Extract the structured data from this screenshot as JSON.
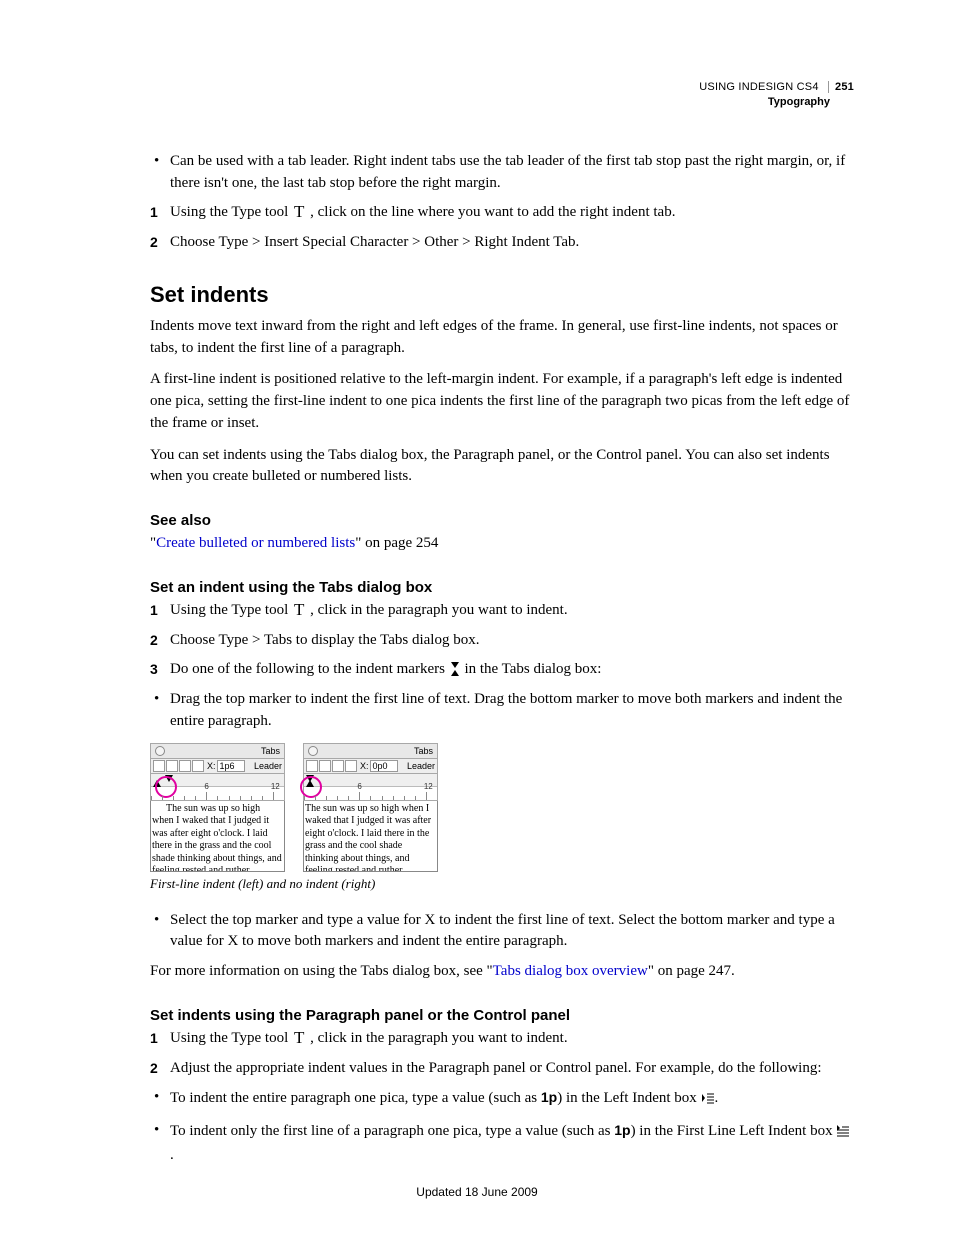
{
  "header": {
    "doc_title": "USING INDESIGN CS4",
    "page_number": "251",
    "section": "Typography"
  },
  "intro": {
    "bullet1": "Can be used with a tab leader. Right indent tabs use the tab leader of the first tab stop past the right margin, or, if there isn't one, the last tab stop before the right margin.",
    "step1a": "Using the Type tool ",
    "step1b": " , click on the line where you want to add the right indent tab.",
    "step2": "Choose Type > Insert Special Character > Other > Right Indent Tab."
  },
  "h_set_indents": "Set indents",
  "p1": "Indents move text inward from the right and left edges of the frame. In general, use first-line indents, not spaces or tabs, to indent the first line of a paragraph.",
  "p2": "A first-line indent is positioned relative to the left-margin indent. For example, if a paragraph's left edge is indented one pica, setting the first-line indent to one pica indents the first line of the paragraph two picas from the left edge of the frame or inset.",
  "p3": "You can set indents using the Tabs dialog box, the Paragraph panel, or the Control panel. You can also set indents when you create bulleted or numbered lists.",
  "see_also_h": "See also",
  "see_also_link": "Create bulleted or numbered lists",
  "see_also_suffix": "\" on page 254",
  "h_tabs": "Set an indent using the Tabs dialog box",
  "tabs_steps": {
    "s1a": "Using the Type tool ",
    "s1b": " , click in the paragraph you want to indent.",
    "s2": "Choose Type > Tabs to display the Tabs dialog box.",
    "s3a": "Do one of the following to the indent markers ",
    "s3b": " in the Tabs dialog box:"
  },
  "tabs_bullet1": "Drag the top marker to indent the first line of text. Drag the bottom marker to move both markers and indent the entire paragraph.",
  "fig": {
    "panel_title": "Tabs",
    "x_label": "X:",
    "x_val_left": "1p6",
    "x_val_right": "0p0",
    "leader_label": "Leader",
    "ruler_6": "6",
    "ruler_12": "12",
    "sample_text": "The sun was up so high when I waked that I judged it was after eight o'clock. I laid there in the grass and the cool shade thinking about things, and feeling rested and ruther comfortable and satisfied. I could see the sun out",
    "caption": "First-line indent (left) and no indent (right)"
  },
  "tabs_bullet2": "Select the top marker and type a value for X to indent the first line of text. Select the bottom marker and type a value for X to move both markers and indent the entire paragraph.",
  "p_moreinfo_a": "For more information on using the Tabs dialog box, see \"",
  "p_moreinfo_link": "Tabs dialog box overview",
  "p_moreinfo_b": "\" on page 247.",
  "h_para": "Set indents using the Paragraph panel or the Control panel",
  "para_steps": {
    "s1a": "Using the Type tool ",
    "s1b": " , click in the paragraph you want to indent.",
    "s2": "Adjust the appropriate indent values in the Paragraph panel or Control panel. For example, do the following:"
  },
  "para_bullets": {
    "b1a": "To indent the entire paragraph one pica, type a value (such as ",
    "b1_val": "1p",
    "b1b": ") in the Left Indent box ",
    "b1c": ".",
    "b2a": "To indent only the first line of a paragraph one pica, type a value (such as ",
    "b2_val": "1p",
    "b2b": ") in the First Line Left Indent box ",
    "b2c": "."
  },
  "footer": "Updated 18 June 2009"
}
